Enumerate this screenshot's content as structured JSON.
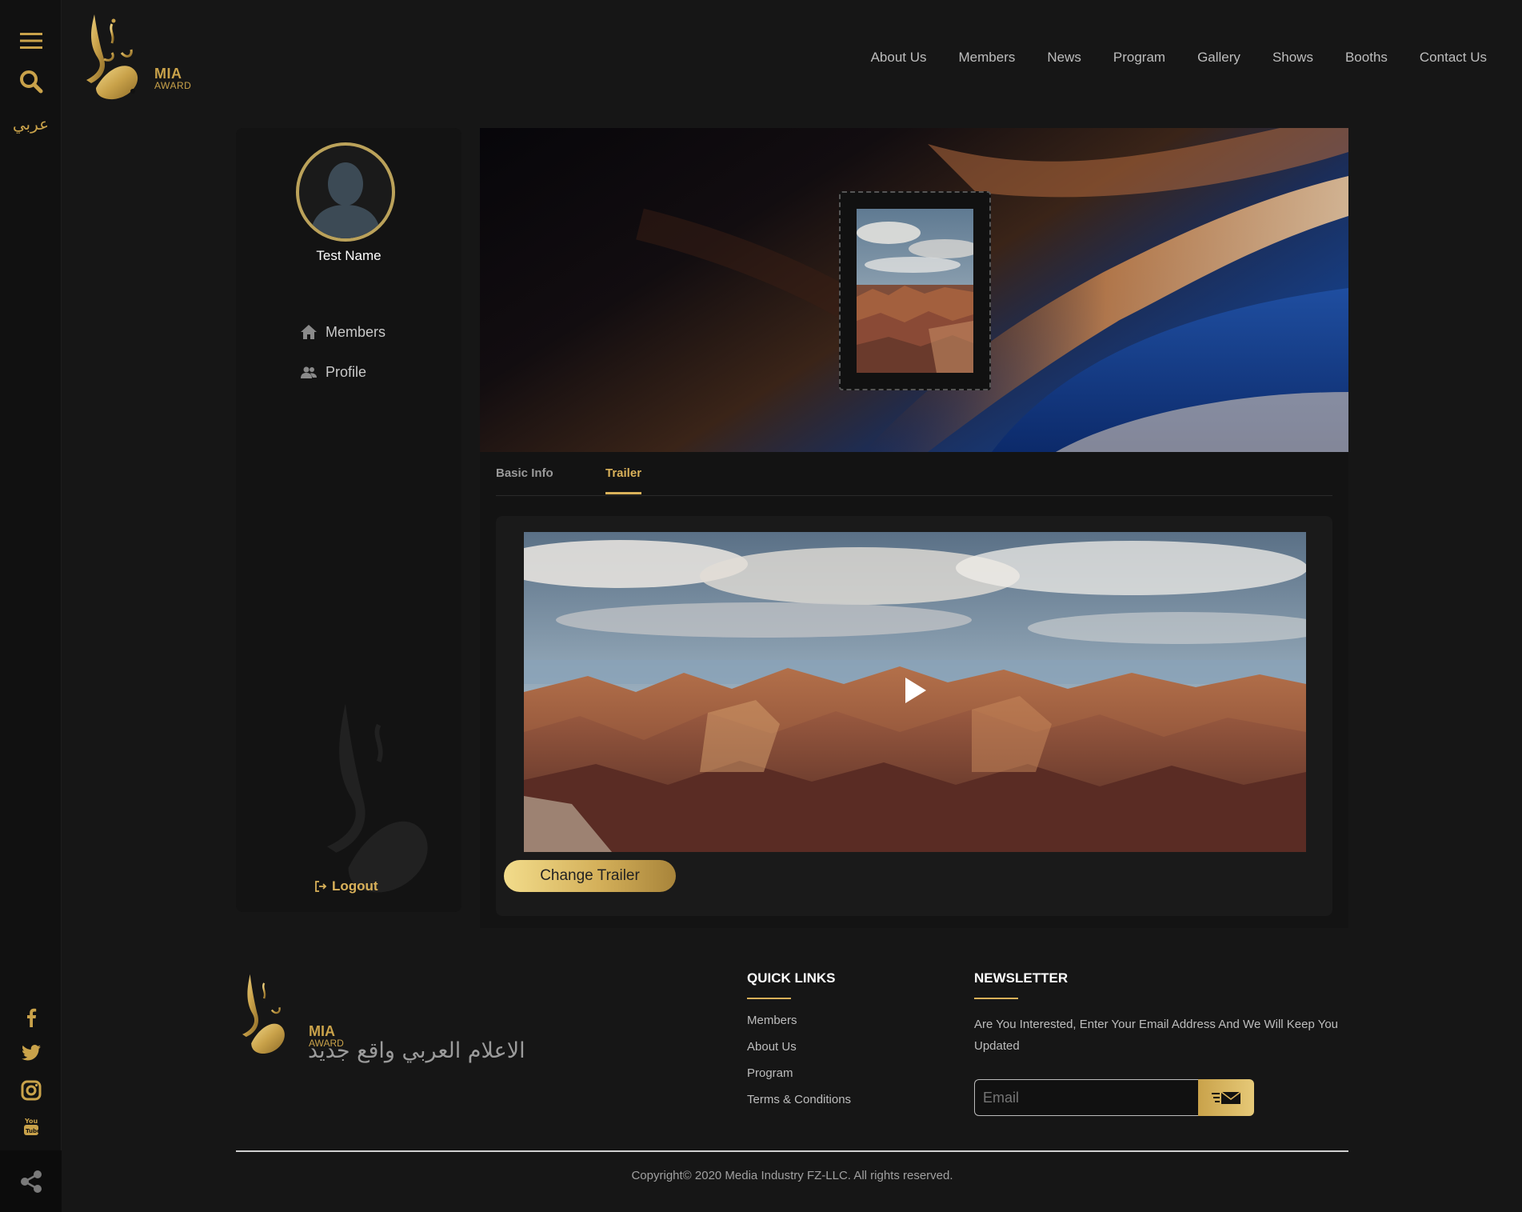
{
  "header": {
    "logo_mia": "MIA",
    "logo_award": "AWARD",
    "nav": [
      "About Us",
      "Members",
      "News",
      "Program",
      "Gallery",
      "Shows",
      "Booths",
      "Contact Us"
    ]
  },
  "rail": {
    "language_link": "عربي",
    "icons": [
      "menu-icon",
      "search-icon",
      "facebook-icon",
      "twitter-icon",
      "instagram-icon",
      "youtube-icon",
      "share-icon"
    ]
  },
  "profile": {
    "name": "Test Name",
    "menu": [
      {
        "label": "Members",
        "icon": "home-icon"
      },
      {
        "label": "Profile",
        "icon": "users-icon"
      }
    ],
    "logout_label": "Logout"
  },
  "tabs": {
    "basic_info": "Basic Info",
    "trailer": "Trailer",
    "active": "Trailer"
  },
  "trailer": {
    "change_button": "Change Trailer"
  },
  "footer": {
    "logo_mia": "MIA",
    "logo_award": "AWARD",
    "tagline": "الاعلام العربي واقع جديد",
    "quick_links_title": "QUICK LINKS",
    "quick_links": [
      "Members",
      "About Us",
      "Program",
      "Terms & Conditions"
    ],
    "newsletter_title": "NEWSLETTER",
    "newsletter_text": "Are You Interested, Enter Your Email Address And We Will Keep You Updated",
    "email_placeholder": "Email",
    "copyright": "Copyright© 2020 Media Industry FZ-LLC. All rights reserved."
  },
  "colors": {
    "accent_gold": "#d9b15a",
    "background": "#161616",
    "panel": "#131313"
  }
}
